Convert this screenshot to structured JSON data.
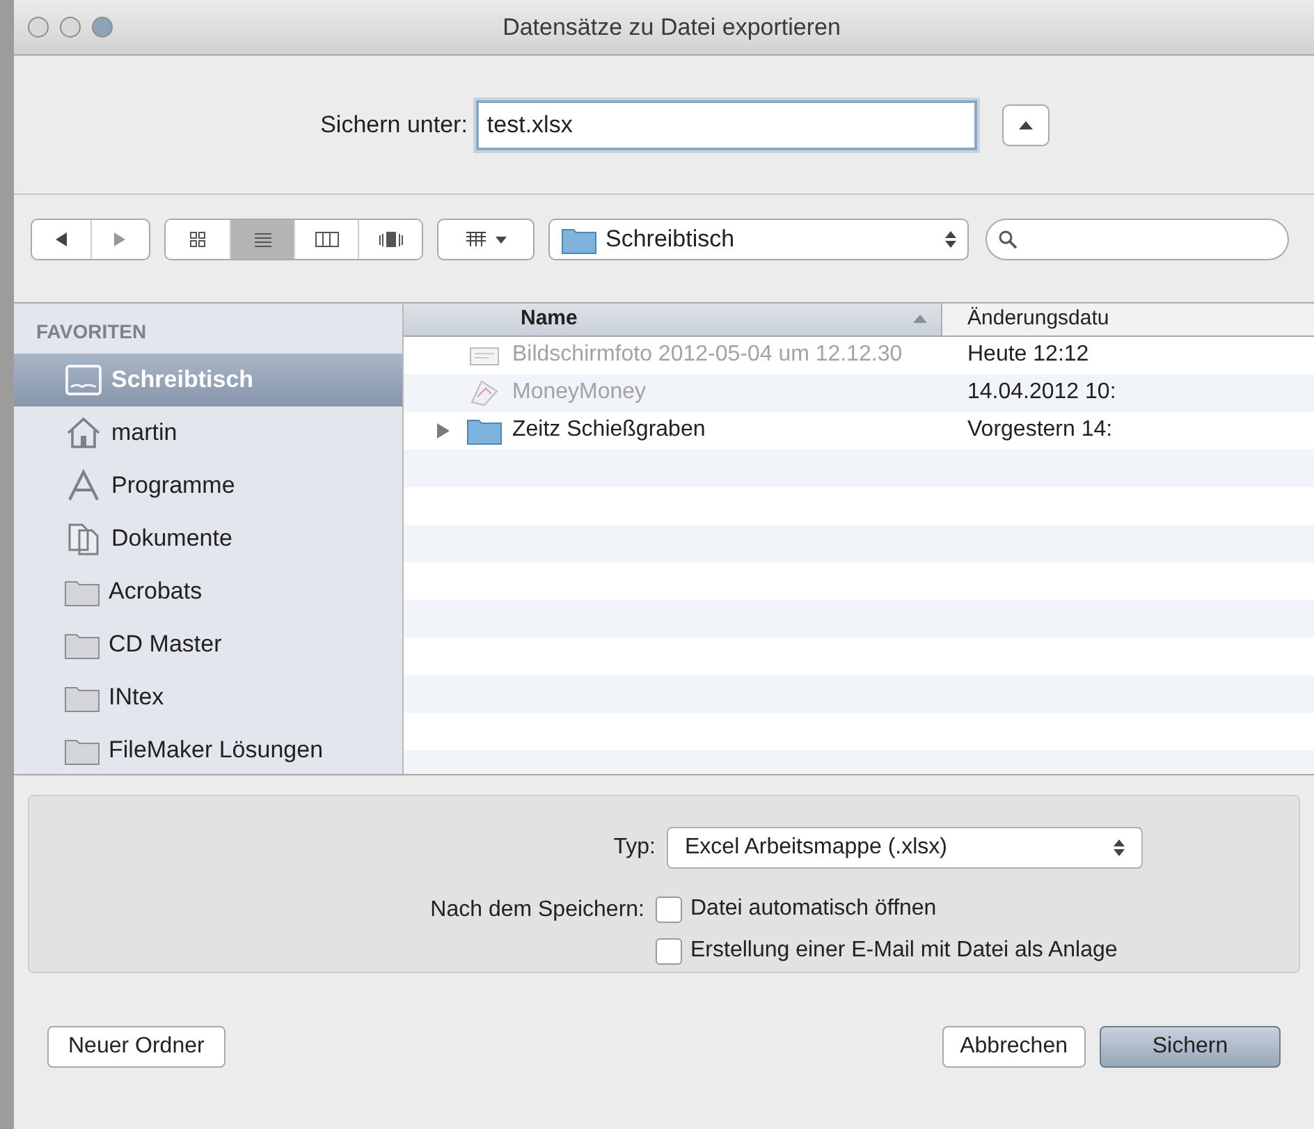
{
  "window": {
    "title": "Datensätze zu Datei exportieren"
  },
  "save_as": {
    "label": "Sichern unter:",
    "value": "test.xlsx"
  },
  "toolbar": {
    "view_modes": [
      {
        "kind": "icons",
        "selected": false
      },
      {
        "kind": "list",
        "selected": true
      },
      {
        "kind": "columns",
        "selected": false
      },
      {
        "kind": "coverflow",
        "selected": false
      }
    ],
    "location": "Schreibtisch"
  },
  "sidebar": {
    "heading": "FAVORITEN",
    "items": [
      {
        "label": "Schreibtisch",
        "kind": "desktop",
        "selected": true
      },
      {
        "label": "martin",
        "kind": "home",
        "selected": false
      },
      {
        "label": "Programme",
        "kind": "apps",
        "selected": false
      },
      {
        "label": "Dokumente",
        "kind": "documents",
        "selected": false
      },
      {
        "label": "Acrobats",
        "kind": "folder",
        "selected": false
      },
      {
        "label": "CD Master",
        "kind": "folder",
        "selected": false
      },
      {
        "label": "INtex",
        "kind": "folder",
        "selected": false
      },
      {
        "label": "FileMaker Lösungen",
        "kind": "folder",
        "selected": false
      }
    ]
  },
  "file_list": {
    "columns": [
      "Name",
      "Änderungsdatu"
    ],
    "rows": [
      {
        "name": "Bildschirmfoto 2012-05-04 um 12.12.30",
        "date": "Heute 12:12",
        "kind": "image",
        "disabled": true,
        "expandable": false
      },
      {
        "name": "MoneyMoney",
        "date": "14.04.2012 10:",
        "kind": "app",
        "disabled": true,
        "expandable": false
      },
      {
        "name": "Zeitz Schießgraben",
        "date": "Vorgestern 14:",
        "kind": "folder",
        "disabled": false,
        "expandable": true
      }
    ]
  },
  "options": {
    "type_label": "Typ:",
    "type_value": "Excel Arbeitsmappe (.xlsx)",
    "after_save_label": "Nach dem Speichern:",
    "checkboxes": [
      {
        "label": "Datei automatisch öffnen",
        "checked": false
      },
      {
        "label": "Erstellung einer E-Mail mit Datei als Anlage",
        "checked": false
      }
    ]
  },
  "buttons": {
    "new_folder": "Neuer Ordner",
    "cancel": "Abbrechen",
    "save": "Sichern"
  }
}
